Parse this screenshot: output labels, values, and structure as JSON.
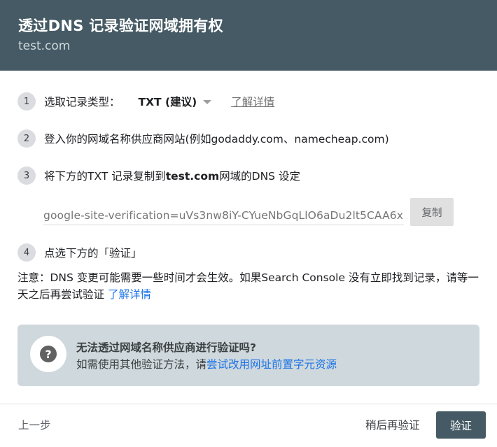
{
  "header": {
    "title": "透过DNS 记录验证网域拥有权",
    "subtitle": "test.com"
  },
  "steps": [
    {
      "number": "1",
      "label": "选取记录类型：",
      "select_value": "TXT (建议)",
      "learn_more": "了解详情"
    },
    {
      "number": "2",
      "label": "登入你的网域名称供应商网站(例如godaddy.com、namecheap.com)"
    },
    {
      "number": "3",
      "label_before": "将下方的TXT 记录复制到",
      "label_domain": "test.com",
      "label_after": "网域的DNS 设定"
    },
    {
      "number": "4",
      "label": "点选下方的「验证」"
    }
  ],
  "record": {
    "value": "google-site-verification=uVs3nw8iY-CYueNbGqLlO6aDu2lt5CAA6x",
    "copy_label": "复制"
  },
  "note": {
    "text": "注意：DNS 变更可能需要一些时间才会生效。如果Search Console 没有立即找到记录，请等一天之后再尝试验证",
    "link": "了解详情"
  },
  "help": {
    "icon": "help-icon",
    "title": "无法透过网域名称供应商进行验证吗?",
    "desc_prefix": "如需使用其他验证方法，请",
    "desc_link": "尝试改用网址前置字元资源"
  },
  "footer": {
    "back_label": "上一步",
    "later_label": "稍后再验证",
    "verify_label": "验证"
  },
  "colors": {
    "header_bg": "#455a64",
    "link": "#1a73e8",
    "help_bg": "#cfd8dc"
  }
}
